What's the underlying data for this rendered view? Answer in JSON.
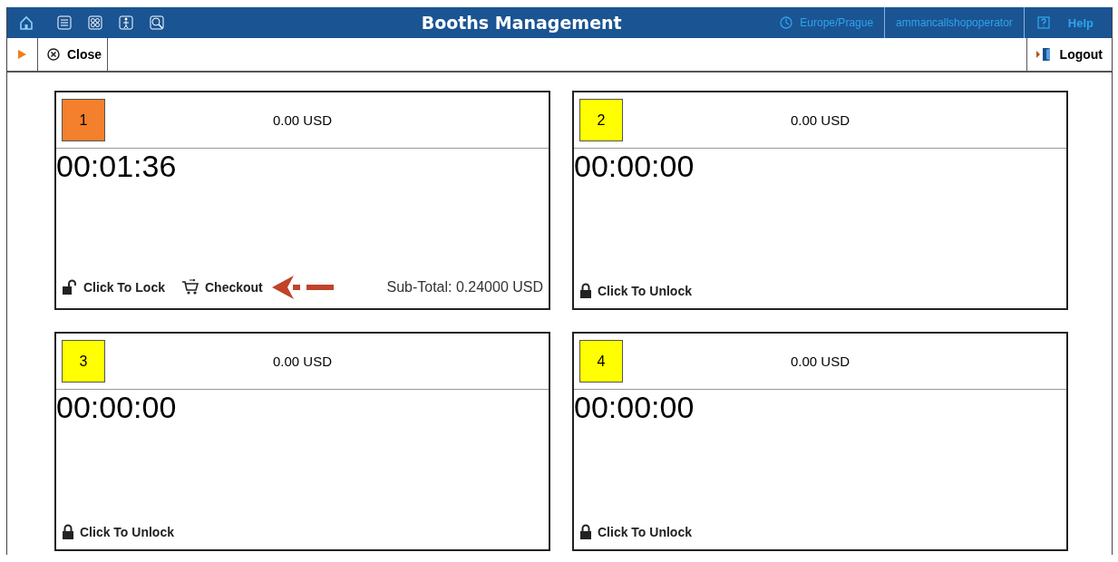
{
  "header": {
    "title": "Booths Management",
    "timezone": "Europe/Prague",
    "user": "ammancallshopoperator",
    "help": "Help"
  },
  "toolbar": {
    "close": "Close",
    "logout": "Logout"
  },
  "booths": [
    {
      "number": "1",
      "color": "#f47f2c",
      "balance": "0.00 USD",
      "timer": "00:01:36",
      "actions": [
        {
          "kind": "lock",
          "label": "Click To Lock"
        },
        {
          "kind": "checkout",
          "label": "Checkout",
          "pointer": true
        }
      ],
      "subtotal": "Sub-Total: 0.24000 USD"
    },
    {
      "number": "2",
      "color": "#ffff00",
      "balance": "0.00 USD",
      "timer": "00:00:00",
      "actions": [
        {
          "kind": "unlock",
          "label": "Click To Unlock"
        }
      ]
    },
    {
      "number": "3",
      "color": "#ffff00",
      "balance": "0.00 USD",
      "timer": "00:00:00",
      "actions": [
        {
          "kind": "unlock",
          "label": "Click To Unlock"
        }
      ]
    },
    {
      "number": "4",
      "color": "#ffff00",
      "balance": "0.00 USD",
      "timer": "00:00:00",
      "actions": [
        {
          "kind": "unlock",
          "label": "Click To Unlock"
        }
      ]
    }
  ]
}
